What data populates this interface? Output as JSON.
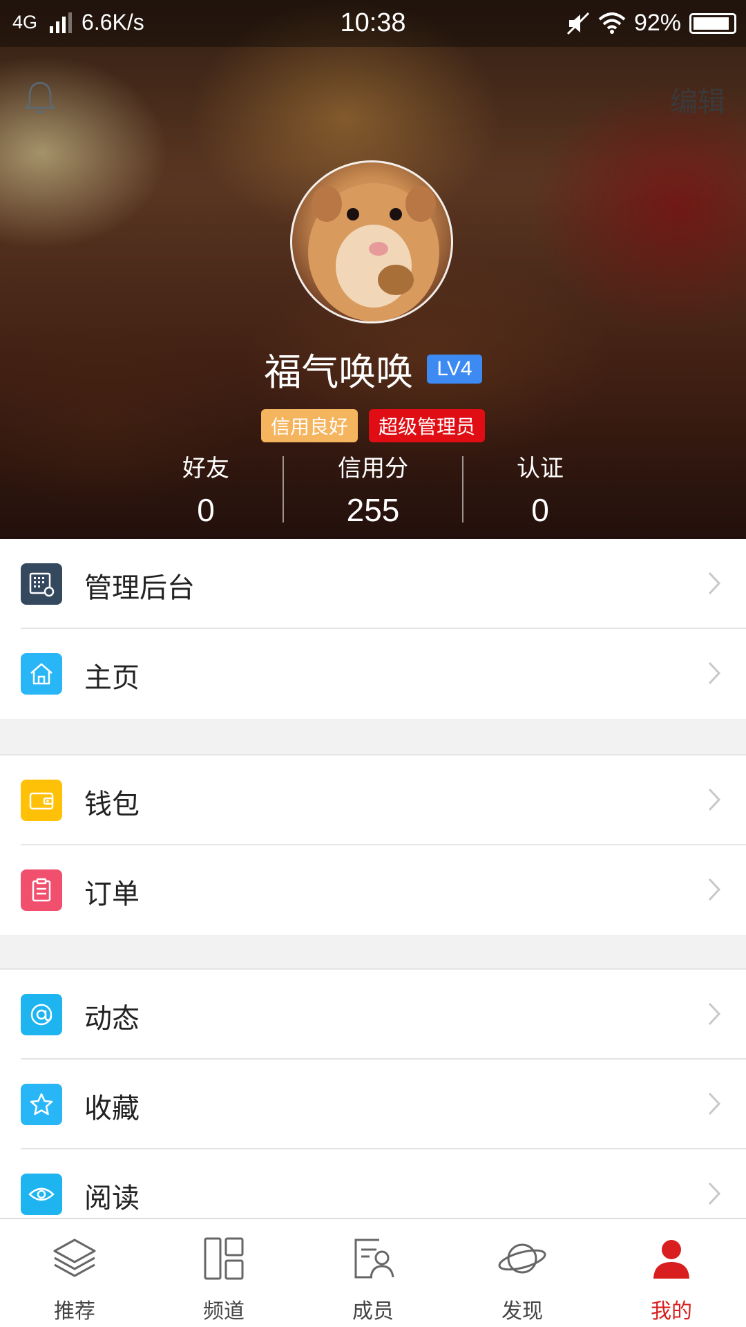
{
  "status_bar": {
    "network": "4G",
    "speed": "6.6K/s",
    "time": "10:38",
    "battery": "92%",
    "battery_level": 0.92
  },
  "header": {
    "bell_icon": "bell-icon",
    "edit_label": "编辑",
    "username": "福气唤唤",
    "level_badge": "LV4",
    "tags": [
      {
        "label": "信用良好",
        "color": "#f5b45e"
      },
      {
        "label": "超级管理员",
        "color": "#e00d14"
      }
    ],
    "stats": [
      {
        "label": "好友",
        "value": "0"
      },
      {
        "label": "信用分",
        "value": "255"
      },
      {
        "label": "认证",
        "value": "0"
      }
    ]
  },
  "menu_groups": [
    [
      {
        "label": "管理后台",
        "icon": "admin-panel-icon",
        "color": "#34495e"
      },
      {
        "label": "主页",
        "icon": "home-icon",
        "color": "#29b6f6"
      }
    ],
    [
      {
        "label": "钱包",
        "icon": "wallet-icon",
        "color": "#ffc107"
      },
      {
        "label": "订单",
        "icon": "order-icon",
        "color": "#f0506e"
      }
    ],
    [
      {
        "label": "动态",
        "icon": "at-icon",
        "color": "#1eb4f0"
      },
      {
        "label": "收藏",
        "icon": "star-icon",
        "color": "#29b6f6"
      },
      {
        "label": "阅读",
        "icon": "eye-icon",
        "color": "#1eb4f0"
      }
    ]
  ],
  "bottom_nav": [
    {
      "label": "推荐",
      "icon": "layers-icon",
      "active": false
    },
    {
      "label": "频道",
      "icon": "grid-icon",
      "active": false
    },
    {
      "label": "成员",
      "icon": "member-card-icon",
      "active": false
    },
    {
      "label": "发现",
      "icon": "planet-icon",
      "active": false
    },
    {
      "label": "我的",
      "icon": "user-icon",
      "active": true
    }
  ],
  "colors": {
    "accent_active": "#d81e1e",
    "level_badge": "#3d8bf2"
  }
}
